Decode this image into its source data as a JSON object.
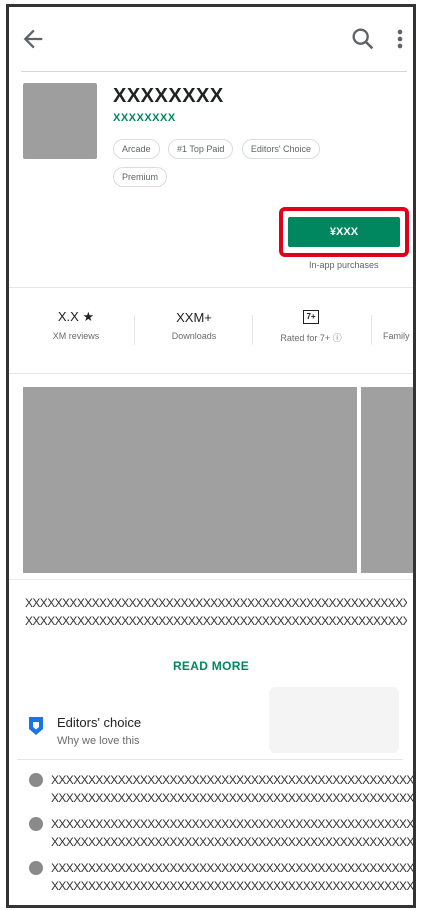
{
  "app": {
    "title": "XXXXXXXX",
    "developer": "XXXXXXXX",
    "tags": [
      "Arcade",
      "#1 Top Paid",
      "Editors' Choice",
      "Premium"
    ],
    "price_button": "¥XXX",
    "in_app_note": "In-app purchases"
  },
  "stats": [
    {
      "value": "X.X ★",
      "label": "XM reviews"
    },
    {
      "value": "XXM+",
      "label": "Downloads"
    },
    {
      "value": "7+",
      "label": "Rated for 7+ ⓘ"
    },
    {
      "value": "",
      "label": "Family"
    }
  ],
  "description": {
    "line1": "XXXXXXXXXXXXXXXXXXXXXXXXXXXXXXXXXXXXXXXXXXXXXXXXXXXXXXXXXXXX",
    "line2": "XXXXXXXXXXXXXXXXXXXXXXXXXXXXXXXXXXXXXXXXXXXXXXXXXXXXXXXXXXXX",
    "read_more": "READ MORE"
  },
  "editors_choice": {
    "title": "Editors' choice",
    "subtitle": "Why we love this"
  },
  "bullets": [
    {
      "line1": "XXXXXXXXXXXXXXXXXXXXXXXXXXXXXXXXXXXXXXXXXXXXXXXXXXXXXXXXX",
      "line2": "XXXXXXXXXXXXXXXXXXXXXXXXXXXXXXXXXXXXXXXXXXXXXXXXXXXXXXXXX"
    },
    {
      "line1": "XXXXXXXXXXXXXXXXXXXXXXXXXXXXXXXXXXXXXXXXXXXXXXXXXXXXXXXXX",
      "line2": "XXXXXXXXXXXXXXXXXXXXXXXXXXXXXXXXXXXXXXXXXXXXXXXXXXXXXXXXX"
    },
    {
      "line1": "XXXXXXXXXXXXXXXXXXXXXXXXXXXXXXXXXXXXXXXXXXXXXXXXXXXXXXXXX",
      "line2": "XXXXXXXXXXXXXXXXXXXXXXXXXXXXXXXXXXXXXXXXXXXXXXXXXXXXXXXXX"
    }
  ],
  "colors": {
    "accent": "#01875f",
    "highlight": "#e0001b"
  }
}
